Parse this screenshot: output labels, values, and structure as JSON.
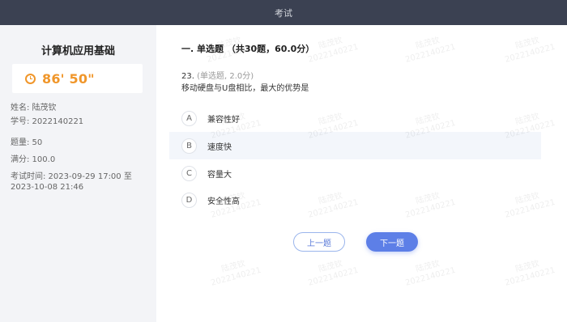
{
  "header": {
    "title": "考试"
  },
  "sidebar": {
    "subject": "计算机应用基础",
    "timer": "86' 50\"",
    "name": "姓名: 陆茂钦",
    "student_id": "学号: 2022140221",
    "question_count": "题量: 50",
    "full_score": "满分: 100.0",
    "exam_time": "考试时间: 2023-09-29  17:00 至 2023-10-08  21:46"
  },
  "main": {
    "section_title": "一. 单选题 （共30题，60.0分）",
    "question": {
      "number": "23.",
      "type": "(单选题, 2.0分)",
      "text": "移动硬盘与U盘相比，最大的优势是"
    },
    "options": [
      {
        "letter": "A",
        "text": "兼容性好"
      },
      {
        "letter": "B",
        "text": "速度快"
      },
      {
        "letter": "C",
        "text": "容量大"
      },
      {
        "letter": "D",
        "text": "安全性高"
      }
    ],
    "prev_label": "上一题",
    "next_label": "下一题"
  },
  "watermark": {
    "name": "陆茂钦",
    "id": "2022140221"
  },
  "colors": {
    "topbar": "#3b4152",
    "timer": "#f0962a",
    "primary": "#5d7fe7"
  },
  "icons": {
    "timer": "clock-icon"
  }
}
